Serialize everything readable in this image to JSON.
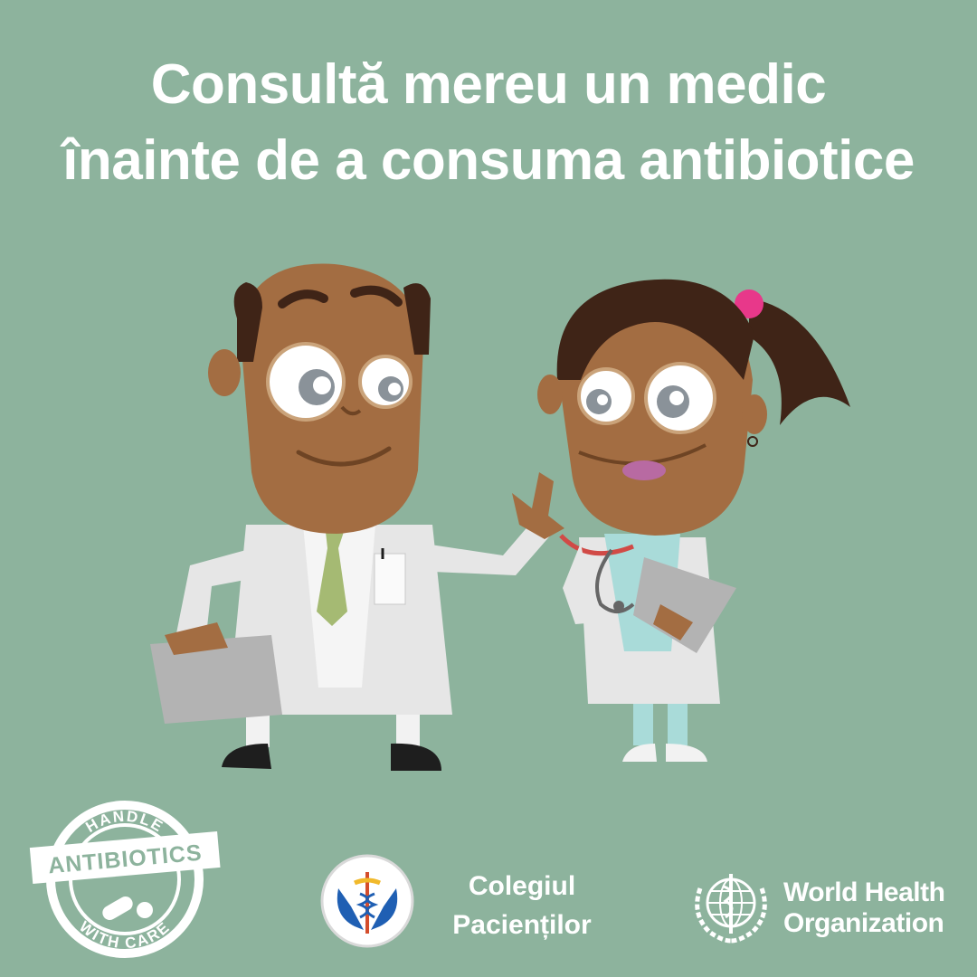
{
  "headline": {
    "line1": "Consultă mereu un medic",
    "line2": "înainte de a consuma antibiotice"
  },
  "badge": {
    "top_text": "HANDLE",
    "banner_text": "ANTIBIOTICS",
    "bottom_text": "WITH CARE",
    "icon": "pills-icon"
  },
  "partners": {
    "colegiul": {
      "line1": "Colegiul",
      "line2": "Pacienților",
      "icon": "caduceus-hands-icon"
    },
    "who": {
      "line1": "World Health",
      "line2": "Organization",
      "icon": "who-emblem-icon"
    }
  },
  "colors": {
    "background": "#8db39d",
    "text": "#ffffff",
    "skin": "#a36d42",
    "coat": "#e6e6e6",
    "tie": "#a5ba73",
    "scrubs": "#a9dbd9",
    "hair_tie": "#e8388a"
  }
}
